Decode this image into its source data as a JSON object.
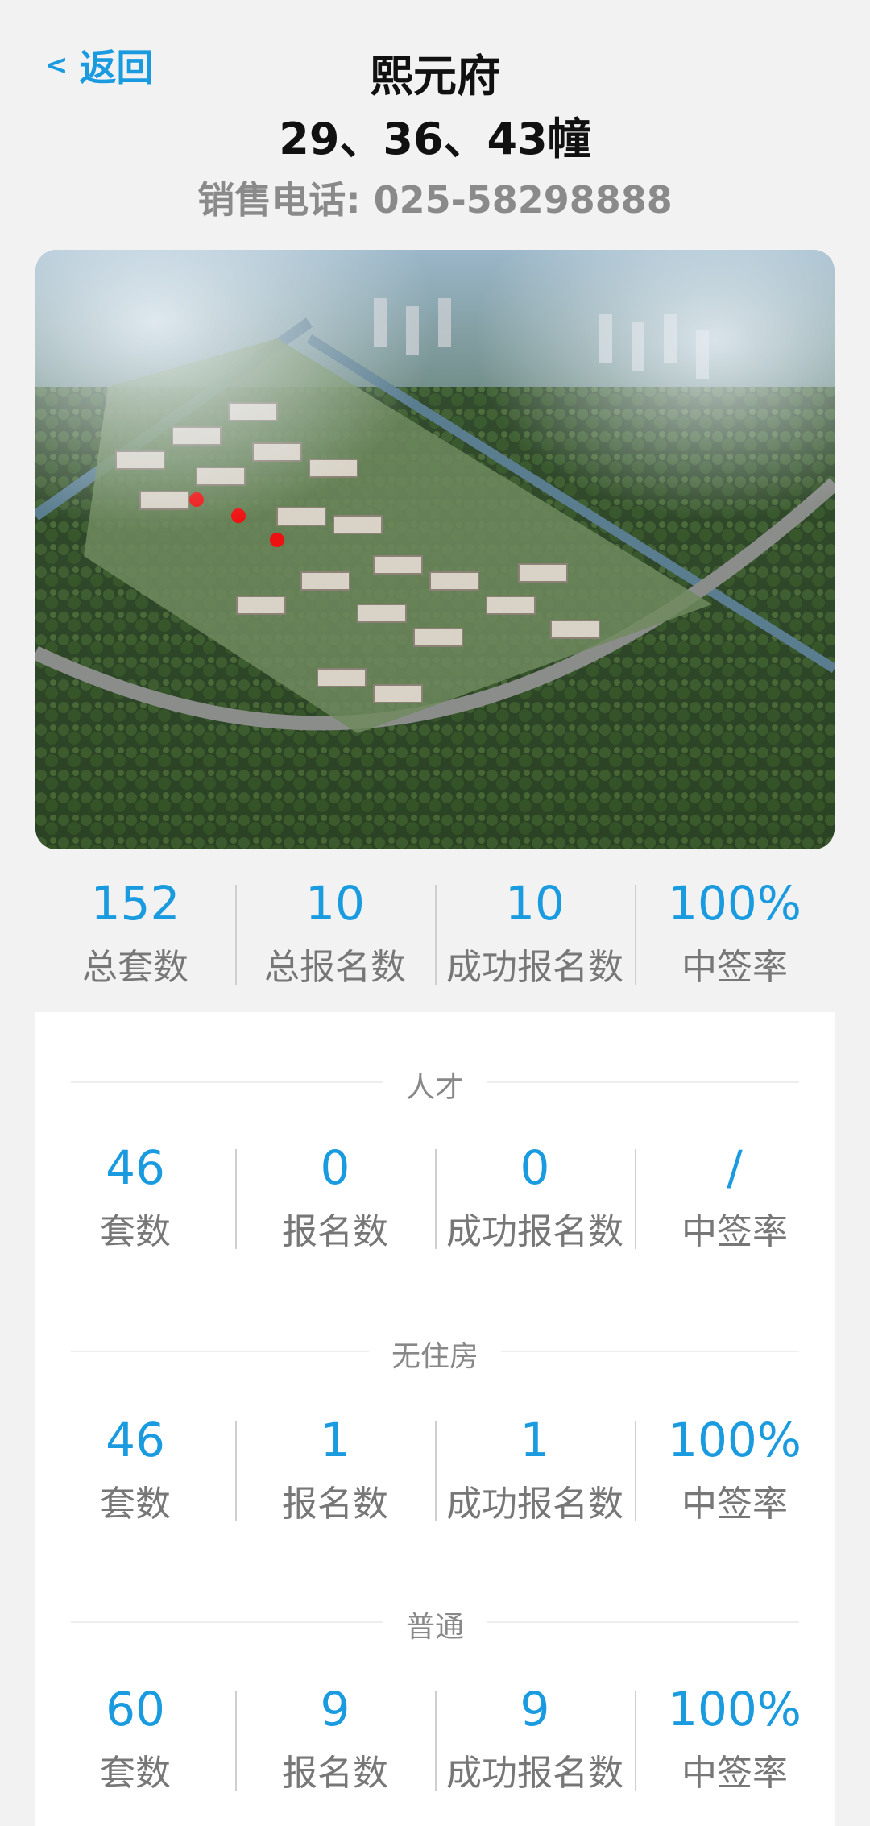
{
  "header": {
    "back_label": "返回",
    "title": "熙元府",
    "subtitle": "29、36、43幢",
    "phone": "销售电话: 025-58298888"
  },
  "summary": [
    {
      "value": "152",
      "label": "总套数"
    },
    {
      "value": "10",
      "label": "总报名数"
    },
    {
      "value": "10",
      "label": "成功报名数"
    },
    {
      "value": "100%",
      "label": "中签率"
    }
  ],
  "sections": [
    {
      "title": "人才",
      "stats": [
        {
          "value": "46",
          "label": "套数"
        },
        {
          "value": "0",
          "label": "报名数"
        },
        {
          "value": "0",
          "label": "成功报名数"
        },
        {
          "value": "/",
          "label": "中签率"
        }
      ]
    },
    {
      "title": "无住房",
      "stats": [
        {
          "value": "46",
          "label": "套数"
        },
        {
          "value": "1",
          "label": "报名数"
        },
        {
          "value": "1",
          "label": "成功报名数"
        },
        {
          "value": "100%",
          "label": "中签率"
        }
      ]
    },
    {
      "title": "普通",
      "stats": [
        {
          "value": "60",
          "label": "套数"
        },
        {
          "value": "9",
          "label": "报名数"
        },
        {
          "value": "9",
          "label": "成功报名数"
        },
        {
          "value": "100%",
          "label": "中签率"
        }
      ]
    }
  ],
  "colors": {
    "accent": "#1a9be0",
    "label": "#777777",
    "background": "#f2f2f2"
  }
}
